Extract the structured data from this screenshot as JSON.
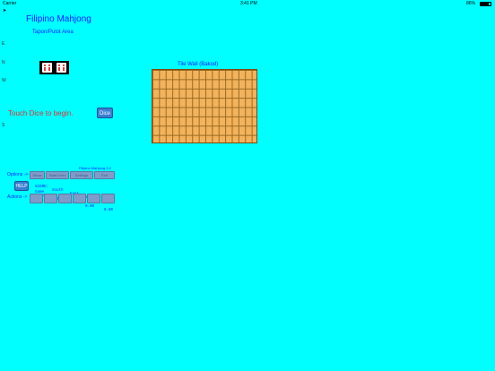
{
  "status_bar": {
    "carrier": "Carrier",
    "time": "3:41 PM",
    "battery": "86%"
  },
  "app": {
    "title": "Filipino Mahjong",
    "subtitle": "Tapon/Pulot Area",
    "version": "Filipino Mahjong 3.2"
  },
  "directions": [
    "E",
    "N",
    "W",
    "S"
  ],
  "dice": {
    "values": [
      6,
      6
    ],
    "pip_color": "#cc0000",
    "button_label": "Dice",
    "prompt": "Touch Dice to begin."
  },
  "tile_wall": {
    "label": "Tile Wall (Bakod)",
    "columns": 16,
    "rows": 8,
    "tile_color": "#f2b35c"
  },
  "controls": {
    "options_label": "Options ->",
    "actions_label": "Actions ->",
    "help_label": "HELP",
    "option_buttons": [
      "Show",
      "Start Over",
      "Settings",
      "Exit"
    ]
  },
  "score_table": {
    "headers": [
      "SCORE:",
      "South",
      "East",
      "North",
      "West"
    ],
    "row_label": "Game",
    "row_number": "0",
    "values": [
      "0.00",
      "0.00",
      "0.00",
      "0.00"
    ]
  },
  "colors": {
    "background": "#00FFFF",
    "title_text": "#1a1aff",
    "prompt_text": "#dd3333",
    "button_blue": "#3a7fd0"
  }
}
